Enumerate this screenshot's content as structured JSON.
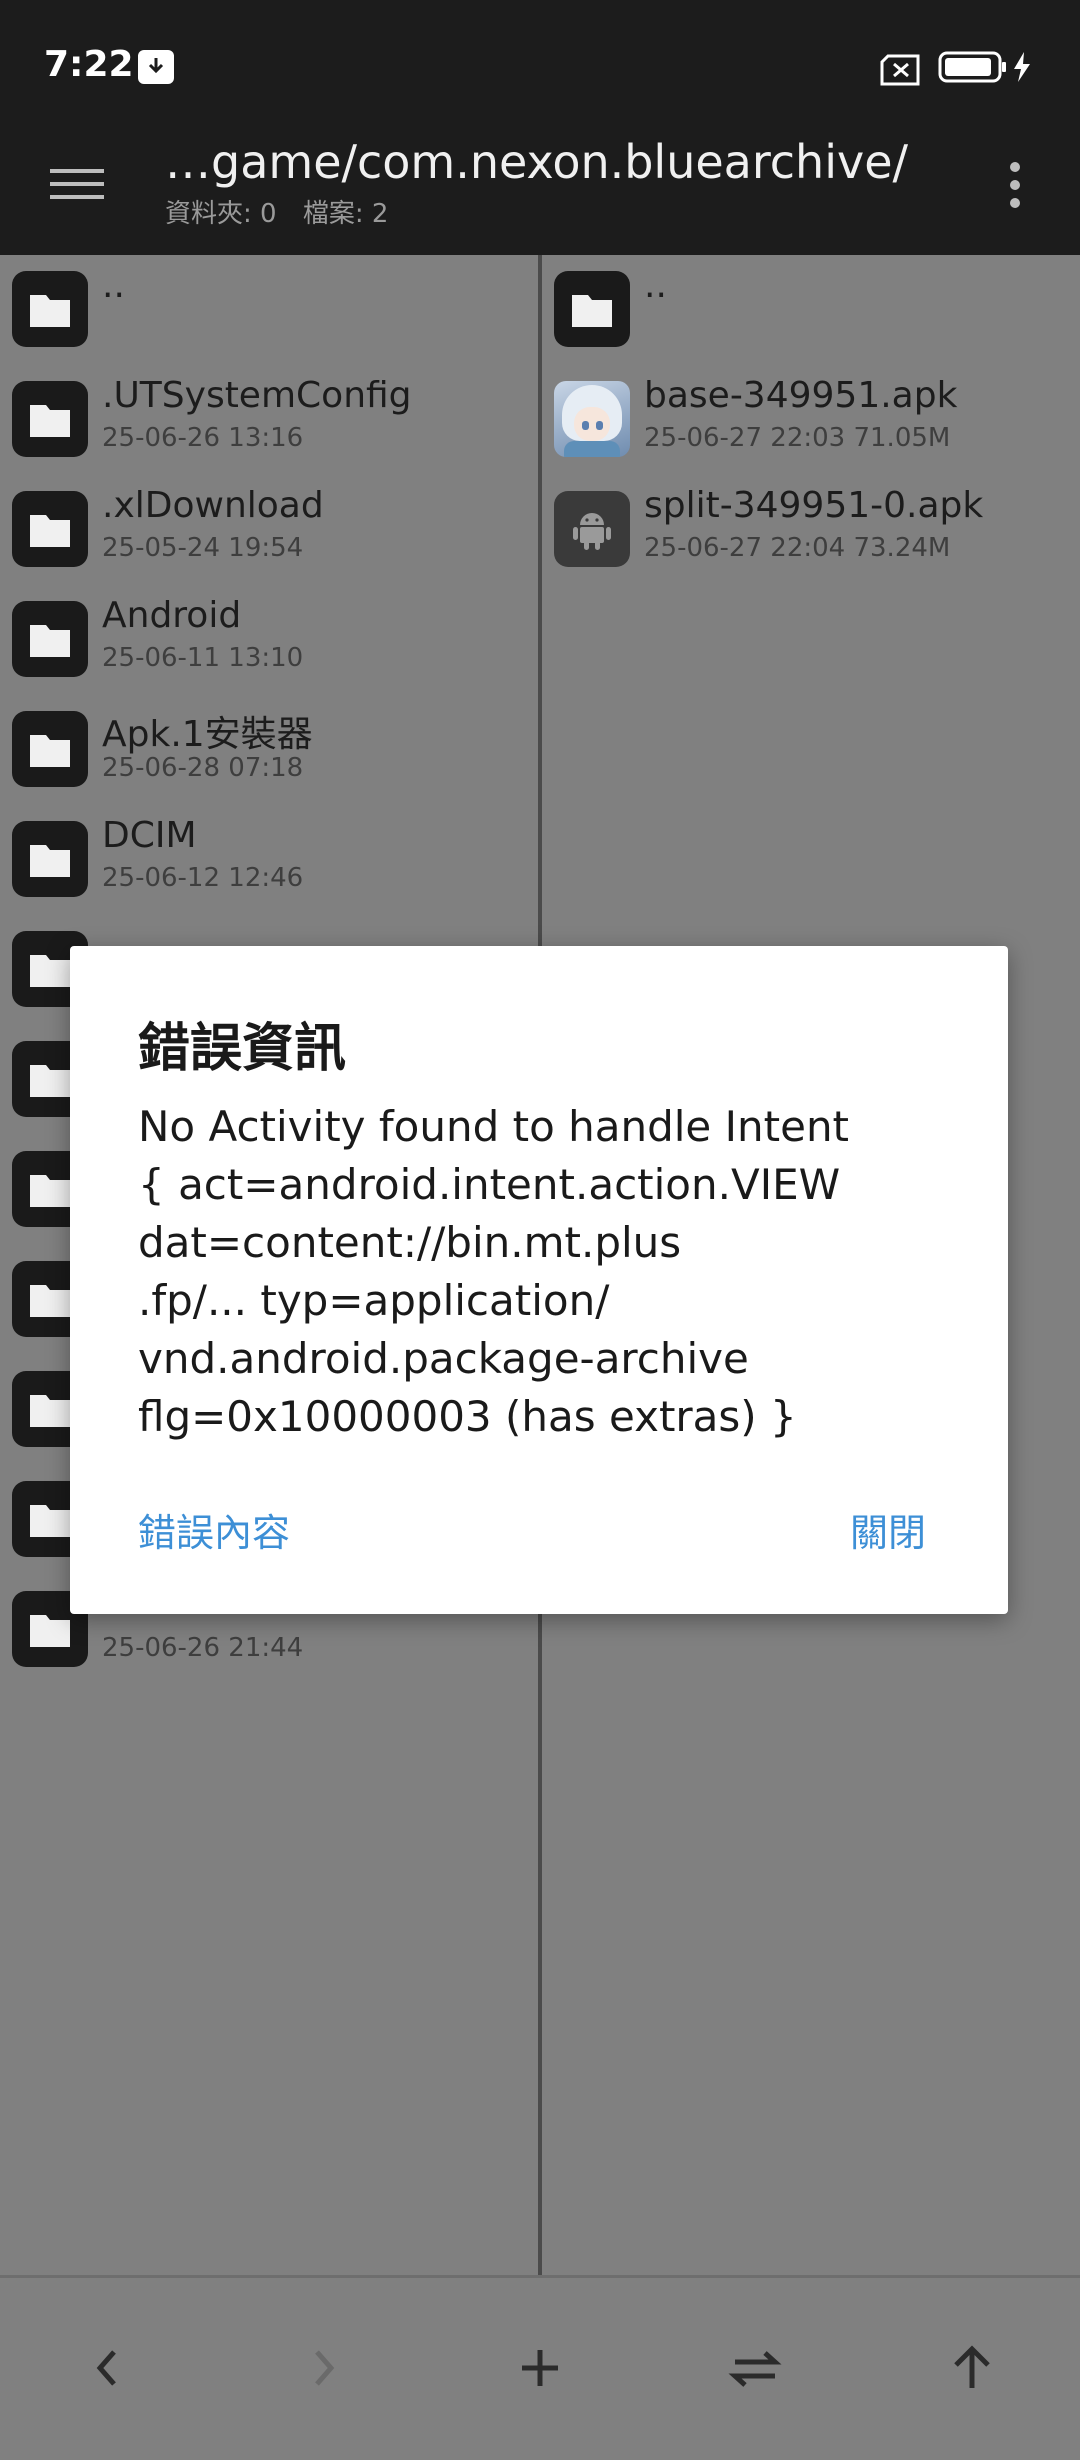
{
  "status_bar": {
    "time": "7:22"
  },
  "toolbar": {
    "path": "…game/com.nexon.bluearchive/",
    "folders_label": "資料夾: 0",
    "files_label": "檔案: 2"
  },
  "left_pane": {
    "items": [
      {
        "name": "..",
        "meta": ""
      },
      {
        "name": ".UTSystemConfig",
        "meta": "25-06-26 13:16"
      },
      {
        "name": ".xlDownload",
        "meta": "25-05-24 19:54"
      },
      {
        "name": "Android",
        "meta": "25-06-11 13:10"
      },
      {
        "name": "Apk.1安裝器",
        "meta": "25-06-28 07:18"
      },
      {
        "name": "DCIM",
        "meta": "25-06-12 12:46"
      },
      {
        "name": "",
        "meta": ""
      },
      {
        "name": "",
        "meta": ""
      },
      {
        "name": "",
        "meta": ""
      },
      {
        "name": "",
        "meta": ""
      },
      {
        "name": "",
        "meta": ""
      },
      {
        "name": "",
        "meta": ""
      },
      {
        "name": "",
        "meta": "25-06-26 21:44"
      }
    ]
  },
  "right_pane": {
    "items": [
      {
        "name": "..",
        "meta": ""
      },
      {
        "name": "base-349951.apk",
        "meta": "25-06-27 22:03  71.05M"
      },
      {
        "name": "split-349951-0.apk",
        "meta": "25-06-27 22:04  73.24M"
      }
    ]
  },
  "dialog": {
    "title": "錯誤資訊",
    "message": "No Activity found to handle Intent\n{ act=android.intent.action.VIEW\ndat=content://bin.mt.plus\n.fp/... typ=application/\nvnd.android.package-archive\nflg=0x10000003 (has extras) }",
    "left_button": "錯誤內容",
    "right_button": "關閉"
  },
  "colors": {
    "accent": "#3d8fd6",
    "toolbar_bg": "#1c1c1c",
    "pane_dimmed_bg": "#808080"
  }
}
